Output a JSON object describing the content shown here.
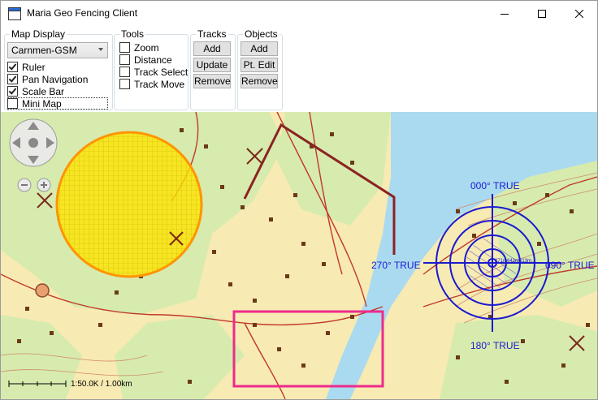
{
  "window": {
    "title": "Maria Geo Fencing Client"
  },
  "map_display": {
    "label": "Map Display",
    "map_select": "Carnmen-GSM",
    "options": [
      {
        "label": "Ruler",
        "checked": true
      },
      {
        "label": "Pan Navigation",
        "checked": true
      },
      {
        "label": "Scale Bar",
        "checked": true
      },
      {
        "label": "Mini Map",
        "checked": false
      }
    ]
  },
  "tools": {
    "label": "Tools",
    "options": [
      {
        "label": "Zoom",
        "checked": false
      },
      {
        "label": "Distance",
        "checked": false
      },
      {
        "label": "Track Select",
        "checked": false
      },
      {
        "label": "Track Move",
        "checked": false
      }
    ]
  },
  "tracks": {
    "label": "Tracks",
    "buttons": [
      "Add",
      "Update",
      "Remove"
    ]
  },
  "objects": {
    "label": "Objects",
    "buttons": [
      "Add",
      "Pt. Edit",
      "Remove"
    ]
  },
  "map": {
    "compass": {
      "north": "000° TRUE",
      "south": "180° TRUE",
      "west": "270° TRUE",
      "east": "090° TRUE",
      "center_label": "271m642m613m..."
    },
    "scale_bar": {
      "label": "1:50.0K / 1.00km"
    },
    "colors": {
      "water": "#aadaf0",
      "land": "#f7eab2",
      "forest": "#d7ebae",
      "road": "#c0392b",
      "track": "#8b2323",
      "geofence_circle": "#ffe400",
      "selection": "#ee2b8b",
      "compass": "#1a1ad0"
    }
  }
}
